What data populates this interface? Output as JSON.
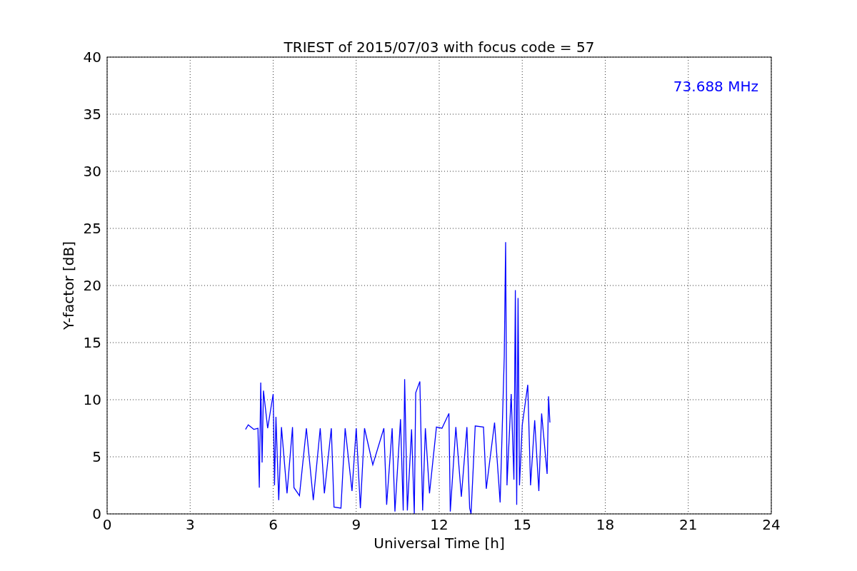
{
  "chart_data": {
    "type": "line",
    "title": "TRIEST of 2015/07/03 with focus code = 57",
    "xlabel": "Universal Time [h]",
    "ylabel": "Y-factor [dB]",
    "xlim": [
      0,
      24
    ],
    "ylim": [
      0,
      40
    ],
    "xticks": [
      0,
      3,
      6,
      9,
      12,
      15,
      18,
      21,
      24
    ],
    "yticks": [
      0,
      5,
      10,
      15,
      20,
      25,
      30,
      35,
      40
    ],
    "x": [
      5.0,
      5.1,
      5.3,
      5.45,
      5.5,
      5.55,
      5.6,
      5.65,
      5.8,
      6.0,
      6.05,
      6.1,
      6.2,
      6.3,
      6.5,
      6.7,
      6.75,
      6.95,
      7.2,
      7.45,
      7.7,
      7.85,
      8.1,
      8.2,
      8.45,
      8.6,
      8.85,
      9.0,
      9.15,
      9.3,
      9.6,
      10.0,
      10.1,
      10.3,
      10.4,
      10.6,
      10.7,
      10.75,
      10.85,
      11.0,
      11.1,
      11.15,
      11.3,
      11.4,
      11.5,
      11.65,
      11.9,
      12.1,
      12.35,
      12.4,
      12.6,
      12.8,
      13.0,
      13.1,
      13.15,
      13.3,
      13.6,
      13.7,
      14.0,
      14.2,
      14.35,
      14.4,
      14.45,
      14.6,
      14.7,
      14.75,
      14.8,
      14.85,
      14.9,
      15.0,
      15.2,
      15.3,
      15.45,
      15.6,
      15.7,
      15.9,
      15.95,
      16.0
    ],
    "series": [
      {
        "color": "#0000ff",
        "values": [
          7.4,
          7.8,
          7.4,
          7.5,
          2.3,
          11.5,
          4.5,
          10.8,
          7.5,
          10.5,
          2.5,
          8.5,
          1.2,
          7.6,
          1.8,
          7.6,
          2.3,
          1.6,
          7.5,
          1.2,
          7.5,
          1.8,
          7.5,
          0.6,
          0.5,
          7.5,
          2.0,
          7.5,
          0.5,
          7.5,
          4.3,
          7.5,
          0.8,
          7.5,
          0.2,
          8.3,
          0.3,
          11.8,
          0.3,
          7.4,
          0,
          10.6,
          11.6,
          0.3,
          7.5,
          1.8,
          7.6,
          7.5,
          8.8,
          0.2,
          7.6,
          1.5,
          7.6,
          0.5,
          0,
          7.7,
          7.6,
          2.2,
          8.0,
          1.0,
          13.8,
          23.8,
          2.5,
          10.5,
          3.0,
          19.6,
          0.8,
          18.9,
          2.5,
          7.8,
          11.3,
          2.5,
          8.2,
          2.0,
          8.8,
          3.5,
          10.3,
          8.0
        ]
      }
    ],
    "grid": true,
    "annotations": [
      "73.688 MHz"
    ]
  }
}
